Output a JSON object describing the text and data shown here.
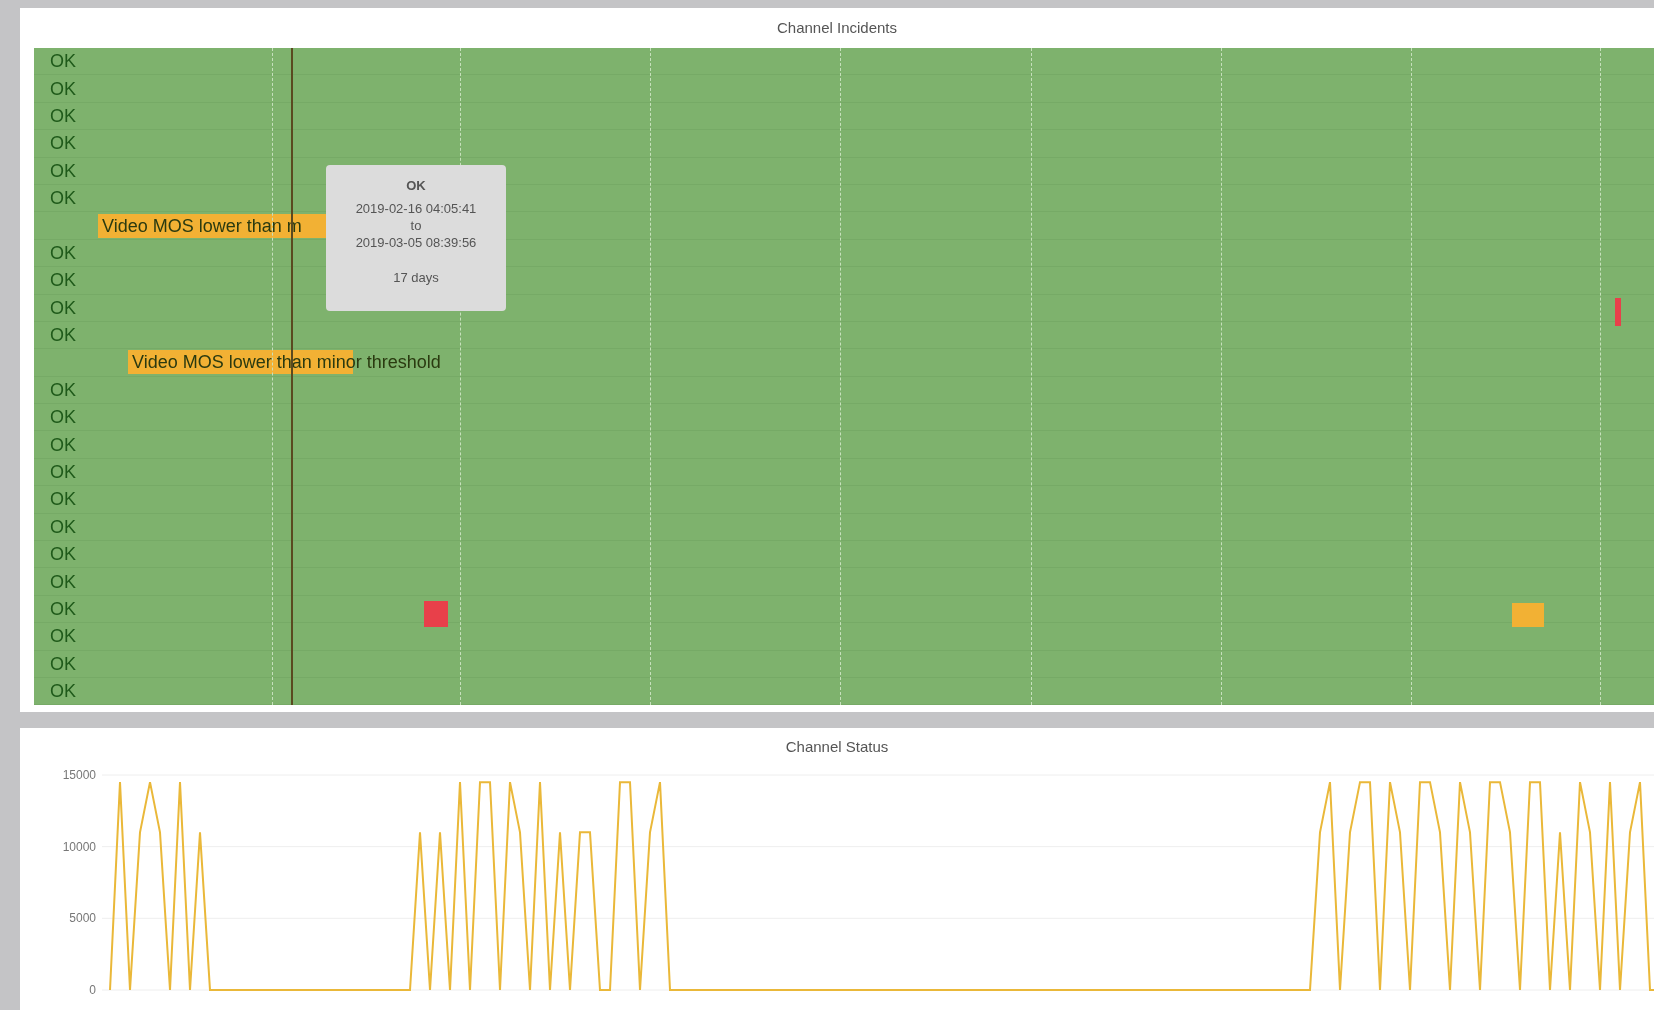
{
  "incidents_panel": {
    "title": "Channel Incidents",
    "rows": [
      {
        "kind": "ok",
        "label": "OK"
      },
      {
        "kind": "ok",
        "label": "OK"
      },
      {
        "kind": "ok",
        "label": "OK"
      },
      {
        "kind": "ok",
        "label": "OK"
      },
      {
        "kind": "ok",
        "label": "OK"
      },
      {
        "kind": "ok",
        "label": "OK"
      },
      {
        "kind": "incident",
        "label": "Video MOS lower than m"
      },
      {
        "kind": "ok",
        "label": "OK"
      },
      {
        "kind": "ok",
        "label": "OK"
      },
      {
        "kind": "ok",
        "label": "OK"
      },
      {
        "kind": "ok",
        "label": "OK"
      },
      {
        "kind": "incident",
        "label": "Video MOS lower than minor threshold"
      },
      {
        "kind": "ok",
        "label": "OK"
      },
      {
        "kind": "ok",
        "label": "OK"
      },
      {
        "kind": "ok",
        "label": "OK"
      },
      {
        "kind": "ok",
        "label": "OK"
      },
      {
        "kind": "ok",
        "label": "OK"
      },
      {
        "kind": "ok",
        "label": "OK"
      },
      {
        "kind": "ok",
        "label": "OK"
      },
      {
        "kind": "ok",
        "label": "OK"
      },
      {
        "kind": "ok",
        "label": "OK"
      },
      {
        "kind": "ok",
        "label": "OK"
      },
      {
        "kind": "ok",
        "label": "OK"
      },
      {
        "kind": "ok",
        "label": "OK"
      }
    ],
    "tooltip": {
      "title": "OK",
      "from": "2019-02-16 04:05:41",
      "separator": "to",
      "to": "2019-03-05 08:39:56",
      "duration": "17 days"
    }
  },
  "status_panel": {
    "title": "Channel Status",
    "chart_data": {
      "type": "line",
      "ylim": [
        0,
        15000
      ],
      "yticks": [
        0,
        5000,
        10000,
        15000
      ],
      "series": [
        {
          "color": "#eab839",
          "values": [
            0,
            14500,
            0,
            11000,
            14500,
            11000,
            0,
            14500,
            0,
            11000,
            0,
            0,
            0,
            0,
            0,
            0,
            0,
            0,
            0,
            0,
            0,
            0,
            0,
            0,
            0,
            0,
            0,
            0,
            0,
            0,
            0,
            11000,
            0,
            11000,
            0,
            14500,
            0,
            14500,
            14500,
            0,
            14500,
            11000,
            0,
            14500,
            0,
            11000,
            0,
            11000,
            11000,
            0,
            0,
            14500,
            14500,
            0,
            11000,
            14500,
            0,
            0,
            0,
            0,
            0,
            0,
            0,
            0,
            0,
            0,
            0,
            0,
            0,
            0,
            0,
            0,
            0,
            0,
            0,
            0,
            0,
            0,
            0,
            0,
            0,
            0,
            0,
            0,
            0,
            0,
            0,
            0,
            0,
            0,
            0,
            0,
            0,
            0,
            0,
            0,
            0,
            0,
            0,
            0,
            0,
            0,
            0,
            0,
            0,
            0,
            0,
            0,
            0,
            0,
            0,
            0,
            0,
            0,
            0,
            0,
            0,
            0,
            0,
            0,
            0,
            11000,
            14500,
            0,
            11000,
            14500,
            14500,
            0,
            14500,
            11000,
            0,
            14500,
            14500,
            11000,
            0,
            14500,
            11000,
            0,
            14500,
            14500,
            11000,
            0,
            14500,
            14500,
            0,
            11000,
            0,
            14500,
            11000,
            0,
            14500,
            0,
            11000,
            14500,
            0,
            0
          ]
        }
      ]
    }
  }
}
